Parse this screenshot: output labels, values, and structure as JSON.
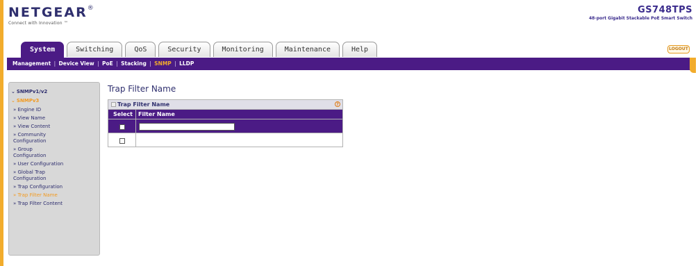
{
  "header": {
    "brand": "NETGEAR",
    "tm": "®",
    "tagline": "Connect with Innovation ™",
    "model": "GS748TPS",
    "model_desc": "48-port Gigabit Stackable PoE Smart Switch"
  },
  "tabs": [
    "System",
    "Switching",
    "QoS",
    "Security",
    "Monitoring",
    "Maintenance",
    "Help"
  ],
  "active_tab": "System",
  "logout_label": "LOGOUT",
  "subnav": [
    "Management",
    "Device View",
    "PoE",
    "Stacking",
    "SNMP",
    "LLDP"
  ],
  "active_subnav": "SNMP",
  "sidebar": {
    "heading1": "SNMPv1/v2",
    "heading2": "SNMPv3",
    "items": [
      {
        "label": "» Engine ID"
      },
      {
        "label": "» View Name"
      },
      {
        "label": "» View Content"
      },
      {
        "label": "» Community",
        "label2": "Configuration"
      },
      {
        "label": "» Group",
        "label2": "Configuration"
      },
      {
        "label": "» User Configuration"
      },
      {
        "label": "» Global Trap",
        "label2": "Configuration"
      },
      {
        "label": "» Trap Configuration"
      },
      {
        "label": "» Trap Filter Name",
        "current": true
      },
      {
        "label": "» Trap Filter Content"
      }
    ]
  },
  "main": {
    "page_title": "Trap Filter Name",
    "table": {
      "caption": "Trap Filter Name",
      "help": "?",
      "headers": [
        "Select",
        "Filter Name"
      ],
      "input_value": "",
      "rows": [
        {
          "filter_name": ""
        }
      ]
    }
  },
  "colors": {
    "purple": "#4b1b85",
    "orange": "#f2ac2c",
    "sidebar_bg": "#d8d8d8"
  }
}
